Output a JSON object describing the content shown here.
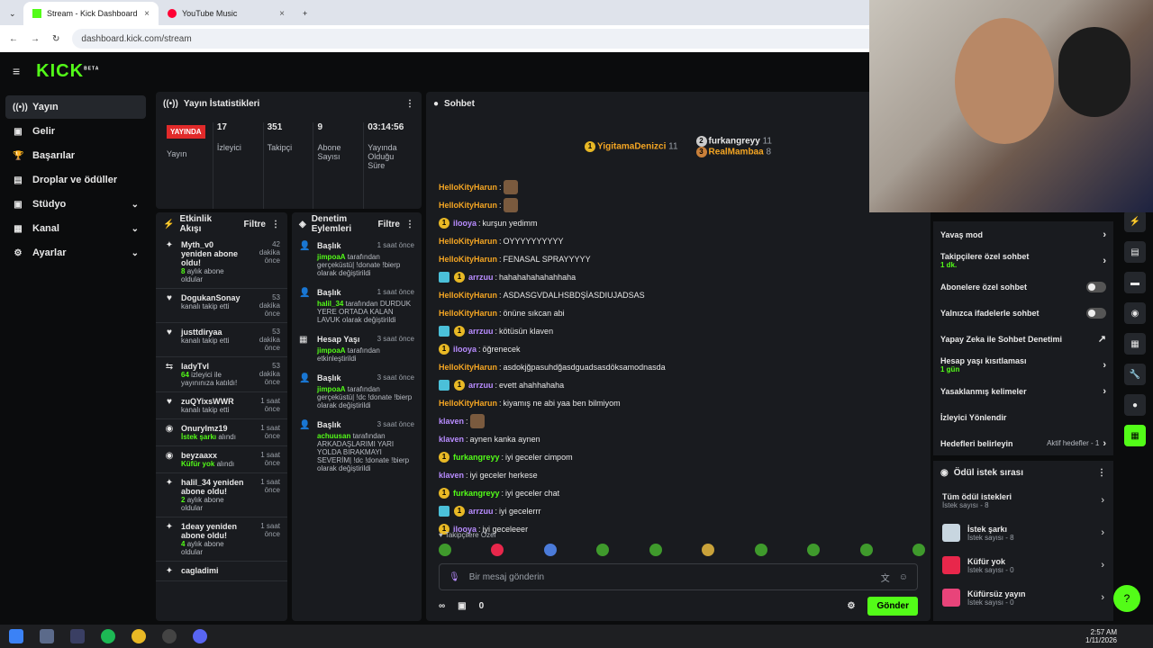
{
  "browser": {
    "tabs": [
      {
        "label": "Stream - Kick Dashboard"
      },
      {
        "label": "YouTube Music"
      }
    ],
    "url": "dashboard.kick.com/stream"
  },
  "brand": {
    "logo": "KICK",
    "beta": "BETA",
    "accent": "#53fc18"
  },
  "nav": [
    {
      "label": "Yayın"
    },
    {
      "label": "Gelir"
    },
    {
      "label": "Başarılar"
    },
    {
      "label": "Droplar ve ödüller"
    },
    {
      "label": "Stüdyo"
    },
    {
      "label": "Kanal"
    },
    {
      "label": "Ayarlar"
    }
  ],
  "stats": {
    "title": "Yayın İstatistikleri",
    "live": "YAYINDA",
    "items": [
      {
        "v": "",
        "l": "Yayın"
      },
      {
        "v": "17",
        "l": "İzleyici"
      },
      {
        "v": "351",
        "l": "Takipçi"
      },
      {
        "v": "9",
        "l": "Abone Sayısı"
      },
      {
        "v": "03:14:56",
        "l": "Yayında Olduğu Süre"
      }
    ]
  },
  "activity": {
    "title": "Etkinlik Akışı",
    "filter": "Filtre",
    "items": [
      {
        "icon": "✦",
        "name": "Myth_v0 yeniden abone oldu!",
        "sub": "8",
        "subtext": "aylık abone oldular",
        "time": "42 dakika önce"
      },
      {
        "icon": "♥",
        "name": "DogukanSonay",
        "sub": "",
        "subtext": "kanalı takip etti",
        "time": "53 dakika önce"
      },
      {
        "icon": "♥",
        "name": "justtdiryaa",
        "sub": "",
        "subtext": "kanalı takip etti",
        "time": "53 dakika önce"
      },
      {
        "icon": "⇆",
        "name": "ladyTvl",
        "sub": "64",
        "subtext": "izleyici ile yayınınıza katıldı!",
        "time": "53 dakika önce"
      },
      {
        "icon": "♥",
        "name": "zuQYixsWWR",
        "sub": "",
        "subtext": "kanalı takip etti",
        "time": "1 saat önce"
      },
      {
        "icon": "◉",
        "name": "Onurylmz19",
        "sub": "İstek şarkı",
        "subtext": "alındı",
        "time": "1 saat önce"
      },
      {
        "icon": "◉",
        "name": "beyzaaxx",
        "sub": "Küfür yok",
        "subtext": "alındı",
        "time": "1 saat önce"
      },
      {
        "icon": "✦",
        "name": "halil_34 yeniden abone oldu!",
        "sub": "2",
        "subtext": "aylık abone oldular",
        "time": "1 saat önce"
      },
      {
        "icon": "✦",
        "name": "1deay yeniden abone oldu!",
        "sub": "4",
        "subtext": "aylık abone oldular",
        "time": "1 saat önce"
      },
      {
        "icon": "✦",
        "name": "cagladimi",
        "sub": "",
        "subtext": "",
        "time": ""
      }
    ]
  },
  "mod": {
    "title": "Denetim Eylemleri",
    "filter": "Filtre",
    "items": [
      {
        "icon": "👤",
        "name": "Başlık",
        "time": "1 saat önce",
        "user": "jimpoaA",
        "desc": "tarafından gerçeküstü| !donate !bierp olarak değiştirildi"
      },
      {
        "icon": "👤",
        "name": "Başlık",
        "time": "1 saat önce",
        "user": "halil_34",
        "desc": "tarafından DURDUK YERE ORTADA KALAN LAVUK olarak değiştirildi"
      },
      {
        "icon": "▦",
        "name": "Hesap Yaşı",
        "time": "3 saat önce",
        "user": "jimpoaA",
        "desc": "tarafından etkinleştirildi"
      },
      {
        "icon": "👤",
        "name": "Başlık",
        "time": "3 saat önce",
        "user": "jimpoaA",
        "desc": "tarafından gerçeküstü| !dc !donate !bierp olarak değiştirildi"
      },
      {
        "icon": "👤",
        "name": "Başlık",
        "time": "3 saat önce",
        "user": "achuusan",
        "desc": "tarafından ARKADAŞLARIMI YARI YOLDA BIRAKMAYI SEVERİM| !dc !donate !bierp olarak değiştirildi"
      }
    ]
  },
  "chat": {
    "title": "Sohbet",
    "pinned": [
      {
        "rank": "1",
        "name": "YigitamaDenizci",
        "count": "11"
      },
      {
        "rank": "2",
        "name": "furkangreyy",
        "count": "11"
      },
      {
        "rank": "3",
        "name": "RealMambaa",
        "count": "8"
      }
    ],
    "messages": [
      {
        "user": "HelloKityHarun",
        "color": "#f5a623",
        "text": "",
        "emote": true
      },
      {
        "user": "HelloKityHarun",
        "color": "#f5a623",
        "text": "",
        "emote": true
      },
      {
        "user": "ilooya",
        "color": "#b88cff",
        "text": "kurşun yedimm",
        "badge": true
      },
      {
        "user": "HelloKityHarun",
        "color": "#f5a623",
        "text": "OYYYYYYYYYY"
      },
      {
        "user": "HelloKityHarun",
        "color": "#f5a623",
        "text": "FENASAL SPRAYYYYY"
      },
      {
        "user": "arrzuu",
        "color": "#b88cff",
        "text": "hahahahahahahhaha",
        "badge": true,
        "sq": true
      },
      {
        "user": "HelloKityHarun",
        "color": "#f5a623",
        "text": "ASDASGVDALHSBDŞİASDIUJADSAS"
      },
      {
        "user": "HelloKityHarun",
        "color": "#f5a623",
        "text": "önüne sıkcan abi"
      },
      {
        "user": "arrzuu",
        "color": "#b88cff",
        "text": "kötüsün klaven",
        "badge": true,
        "sq": true
      },
      {
        "user": "ilooya",
        "color": "#b88cff",
        "text": "öğrenecek",
        "badge": true
      },
      {
        "user": "HelloKityHarun",
        "color": "#f5a623",
        "text": "asdokjğpasuhdğasdguadsasdöksamodnasda"
      },
      {
        "user": "arrzuu",
        "color": "#b88cff",
        "text": "evett ahahhahaha",
        "badge": true,
        "sq": true
      },
      {
        "user": "HelloKityHarun",
        "color": "#f5a623",
        "text": "kiyamış ne abi yaa ben bilmiyom"
      },
      {
        "user": "klaven",
        "color": "#b88cff",
        "text": "",
        "emote": true
      },
      {
        "user": "klaven",
        "color": "#b88cff",
        "text": "aynen kanka aynen"
      },
      {
        "user": "furkangreyy",
        "color": "#53fc18",
        "text": "iyi geceler cimpom",
        "badge": true
      },
      {
        "user": "klaven",
        "color": "#b88cff",
        "text": "iyi geceler herkese"
      },
      {
        "user": "furkangreyy",
        "color": "#53fc18",
        "text": "iyi geceler chat",
        "badge": true
      },
      {
        "user": "arrzuu",
        "color": "#b88cff",
        "text": "iyi gecelerrr",
        "badge": true,
        "sq": true
      },
      {
        "user": "ilooya",
        "color": "#b88cff",
        "text": "iyi geceleeer",
        "badge": true
      }
    ],
    "followers_only": "Takipçilere Özel",
    "placeholder": "Bir mesaj gönderin",
    "send": "Gönder",
    "count": "0"
  },
  "settings": [
    {
      "label": "Yavaş mod",
      "sub": "",
      "ctl": "chev"
    },
    {
      "label": "Takipçilere özel sohbet",
      "sub": "1 dk.",
      "ctl": "chev"
    },
    {
      "label": "Abonelere özel sohbet",
      "sub": "",
      "ctl": "toggle"
    },
    {
      "label": "Yalnızca ifadelerle sohbet",
      "sub": "",
      "ctl": "toggle"
    },
    {
      "label": "Yapay Zeka ile Sohbet Denetimi",
      "sub": "",
      "ctl": "ext"
    },
    {
      "label": "Hesap yaşı kısıtlaması",
      "sub": "1 gün",
      "ctl": "chev"
    },
    {
      "label": "Yasaklanmış kelimeler",
      "sub": "",
      "ctl": "chev"
    },
    {
      "label": "İzleyici Yönlendir",
      "sub": "",
      "ctl": ""
    },
    {
      "label": "Hedefleri belirleyin",
      "sub": "",
      "ctl": "chev",
      "note": "Aktif hedefler - 1"
    }
  ],
  "rewards": {
    "title": "Ödül istek sırası",
    "items": [
      {
        "name": "Tüm ödül istekleri",
        "count": "İstek sayısı - 8",
        "color": ""
      },
      {
        "name": "İstek şarkı",
        "count": "İstek sayısı - 8",
        "color": "#c8d6e0"
      },
      {
        "name": "Küfür yok",
        "count": "İstek sayısı - 0",
        "color": "#e8274b"
      },
      {
        "name": "Küfürsüz yayın",
        "count": "İstek sayısı - 0",
        "color": "#e8447a"
      }
    ]
  },
  "clock": {
    "time": "2:57 AM",
    "date": "1/11/2026"
  }
}
